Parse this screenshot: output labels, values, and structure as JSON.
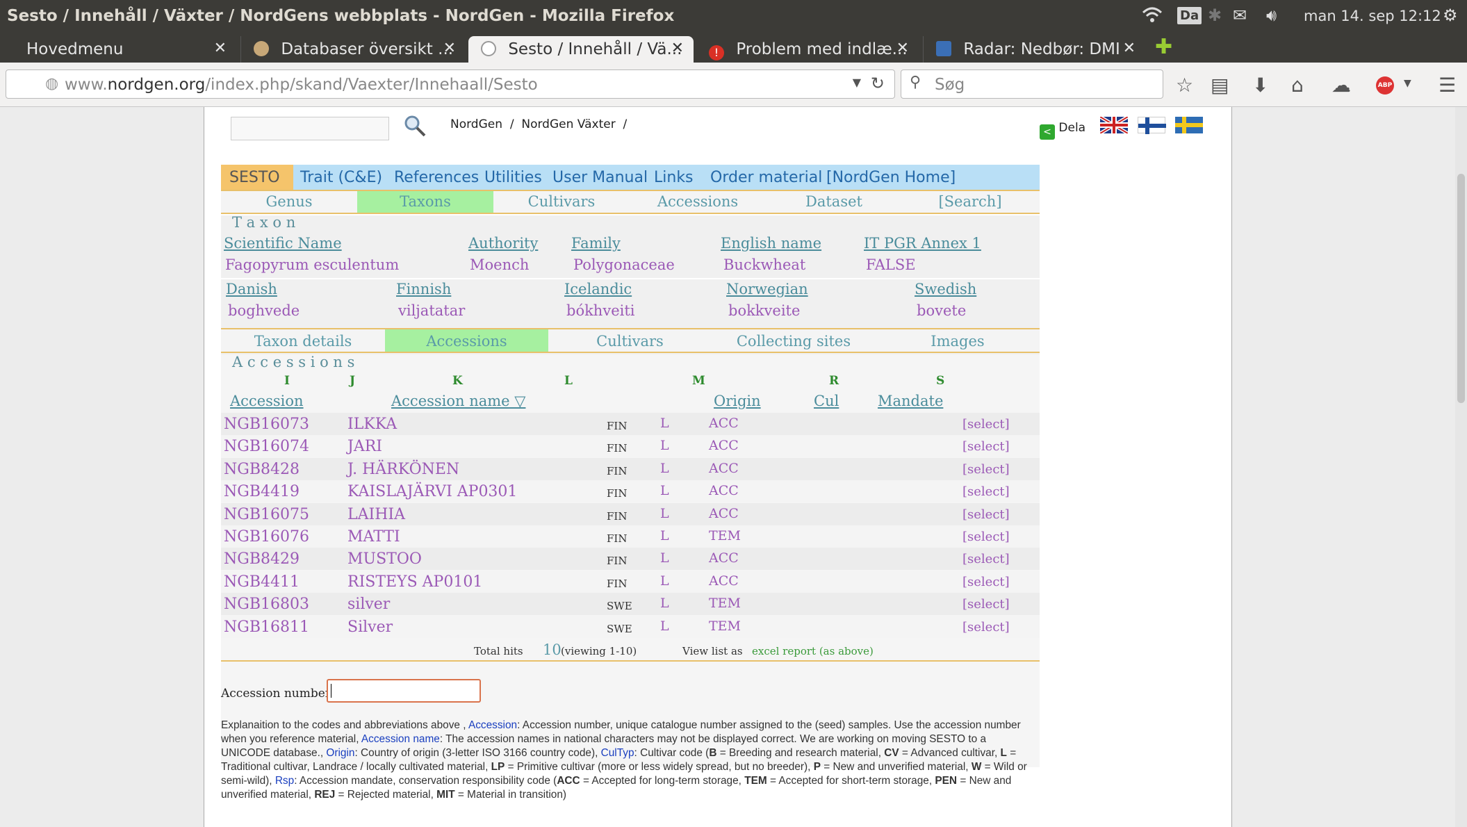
{
  "window": {
    "title": "Sesto / Innehåll / Växter / NordGens webbplats - NordGen - Mozilla Firefox",
    "tray_lang": "Da",
    "clock": "man 14. sep 12:12"
  },
  "tabs": [
    {
      "label": "Hovedmenu"
    },
    {
      "label": "Databaser översikt ..."
    },
    {
      "label": "Sesto / Innehåll / Vä..."
    },
    {
      "label": "Problem med indlæ..."
    },
    {
      "label": "Radar: Nedbør: DMI"
    }
  ],
  "nav": {
    "url_domain_prefix": "www.",
    "url_domain": "nordgen.org",
    "url_path": "/index.php/skand/Vaexter/Innehaall/Sesto",
    "search_placeholder": "Søg"
  },
  "site": {
    "breadcrumb": [
      "NordGen",
      "/",
      "NordGen Växter",
      "/"
    ],
    "share_label": "Dela",
    "menu": [
      "SESTO",
      "Trait (C&E)",
      "References",
      "Utilities",
      "User Manual",
      "Links",
      "Order material",
      "[NordGen Home]"
    ],
    "subtabs": [
      "Genus",
      "Taxons",
      "Cultivars",
      "Accessions",
      "Dataset",
      "[Search]"
    ],
    "taxon_heading": "T a x o n",
    "taxon_headers": [
      "Scientific Name",
      "Authority",
      "Family",
      "English name",
      "IT PGR Annex 1"
    ],
    "taxon_values": [
      "Fagopyrum esculentum",
      "Moench",
      "Polygonaceae",
      "Buckwheat",
      "FALSE"
    ],
    "lang_headers": [
      "Danish",
      "Finnish",
      "Icelandic",
      "Norwegian",
      "Swedish"
    ],
    "lang_values": [
      "boghvede",
      "viljatatar",
      "bókhveiti",
      "bokkveite",
      "bovete"
    ],
    "taxon_tabs": [
      "Taxon details",
      "Accessions",
      "Cultivars",
      "Collecting sites",
      "Images"
    ],
    "acc_heading": "A c c e s s i o n s",
    "letters": [
      "I",
      "J",
      "K",
      "L",
      "M",
      "R",
      "S"
    ],
    "acc_headers": [
      "Accession",
      "Accession name ▽",
      "Origin",
      "Cul",
      "Mandate"
    ],
    "rows": [
      {
        "id": "NGB16073",
        "name": "ILKKA",
        "origin": "FIN",
        "cul": "L",
        "mandate": "ACC",
        "sel": "[select]"
      },
      {
        "id": "NGB16074",
        "name": "JARI",
        "origin": "FIN",
        "cul": "L",
        "mandate": "ACC",
        "sel": "[select]"
      },
      {
        "id": "NGB8428",
        "name": "J. HÄRKÖNEN",
        "origin": "FIN",
        "cul": "L",
        "mandate": "ACC",
        "sel": "[select]"
      },
      {
        "id": "NGB4419",
        "name": "KAISLAJÄRVI AP0301",
        "origin": "FIN",
        "cul": "L",
        "mandate": "ACC",
        "sel": "[select]"
      },
      {
        "id": "NGB16075",
        "name": "LAIHIA",
        "origin": "FIN",
        "cul": "L",
        "mandate": "ACC",
        "sel": "[select]"
      },
      {
        "id": "NGB16076",
        "name": "MATTI",
        "origin": "FIN",
        "cul": "L",
        "mandate": "TEM",
        "sel": "[select]"
      },
      {
        "id": "NGB8429",
        "name": "MUSTOO",
        "origin": "FIN",
        "cul": "L",
        "mandate": "ACC",
        "sel": "[select]"
      },
      {
        "id": "NGB4411",
        "name": "RISTEYS AP0101",
        "origin": "FIN",
        "cul": "L",
        "mandate": "ACC",
        "sel": "[select]"
      },
      {
        "id": "NGB16803",
        "name": "silver",
        "origin": "SWE",
        "cul": "L",
        "mandate": "TEM",
        "sel": "[select]"
      },
      {
        "id": "NGB16811",
        "name": "Silver",
        "origin": "SWE",
        "cul": "L",
        "mandate": "TEM",
        "sel": "[select]"
      }
    ],
    "total_hits_label": "Total hits",
    "total_hits": "10",
    "viewing": "(viewing 1-10)",
    "view_list_label": "View list as",
    "excel_label": "excel report (as above)",
    "acc_number_label": "Accession number :",
    "expl": {
      "p1": "Explanaition to the codes and abbreviations above , ",
      "k1": "Accession",
      "p2": ": Accession number, unique catalogue number assigned to the (seed) samples. Use the accession number when you reference material, ",
      "k2": "Accession name",
      "p3": ": The accession names in national characters may not be displayed correct. We are working on moving SESTO to a UNICODE database., ",
      "k3": "Origin",
      "p4": ": Country of origin (3-letter ISO 3166 country code), ",
      "k4": "CulTyp",
      "p5": ": Cultivar code (",
      "b1": "B",
      "p6": " = Breeding and research material, ",
      "b2": "CV",
      "p7": " = Advanced cultivar, ",
      "b3": "L",
      "p8": " = Traditional cultivar, Landrace / locally cultivated material, ",
      "b4": "LP",
      "p9": " = Primitive cultivar (more or less widely spread, but no breeder), ",
      "b5": "P",
      "p10": " = New and unverified material, ",
      "b6": "W",
      "p11": " = Wild or semi-wild), ",
      "k5": "Rsp",
      "p12": ": Accession mandate, conservation responsibility code (",
      "b7": "ACC",
      "p13": " = Accepted for long-term storage, ",
      "b8": "TEM",
      "p14": " = Accepted for short-term storage, ",
      "b9": "PEN",
      "p15": " = New and unverified material, ",
      "b10": "REJ",
      "p16": " = Rejected material, ",
      "b11": "MIT",
      "p17": " = Material in transition)"
    }
  },
  "colors": {
    "menu_bg": "#b9dff6",
    "active_tab": "#a6f0a0",
    "accent": "#e8c06a",
    "link": "#9b59b6"
  }
}
